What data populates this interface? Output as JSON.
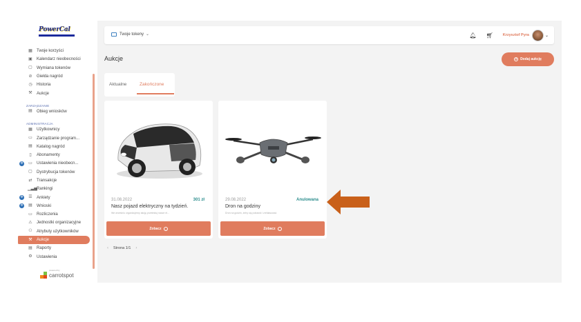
{
  "logo": {
    "text": "PowerCal"
  },
  "sidebar": {
    "items": [
      {
        "label": "Twoje korzyści",
        "icon": "grid-icon"
      },
      {
        "label": "Kalendarz nieobecności",
        "icon": "calendar-icon"
      },
      {
        "label": "Wymiana tokenów",
        "icon": "token-icon"
      },
      {
        "label": "Giełda nagród",
        "icon": "exchange-icon"
      },
      {
        "label": "Historia",
        "icon": "history-icon"
      },
      {
        "label": "Aukcje",
        "icon": "auction-icon"
      }
    ],
    "section_manage": "ZARZĄDZANIE",
    "manage_items": [
      {
        "label": "Obieg wniosków",
        "icon": "flow-icon"
      }
    ],
    "section_admin": "ADMINISTRACJA",
    "admin_items": [
      {
        "label": "Użytkownicy",
        "icon": "users-icon"
      },
      {
        "label": "Zarządzanie program...",
        "icon": "program-icon"
      },
      {
        "label": "Katalog nagród",
        "icon": "catalog-icon"
      },
      {
        "label": "Abonamenty",
        "icon": "subscription-icon"
      },
      {
        "label": "Ustawienia nieobecn...",
        "icon": "absence-settings-icon"
      },
      {
        "label": "Dystrybucja tokenów",
        "icon": "distribution-icon"
      },
      {
        "label": "Transakcje",
        "icon": "transactions-icon"
      },
      {
        "label": "Rankingi",
        "icon": "ranking-icon"
      },
      {
        "label": "Ankiety",
        "icon": "survey-icon"
      },
      {
        "label": "Wnioski",
        "icon": "requests-icon"
      },
      {
        "label": "Rozliczenia",
        "icon": "settlements-icon"
      },
      {
        "label": "Jednostki organizacyjne",
        "icon": "org-units-icon"
      },
      {
        "label": "Atrybuty użytkowników",
        "icon": "attributes-icon"
      },
      {
        "label": "Aukcje",
        "icon": "auction-icon"
      },
      {
        "label": "Raporty",
        "icon": "reports-icon"
      },
      {
        "label": "Ustawienia",
        "icon": "settings-icon"
      }
    ],
    "powered_by": "powered by",
    "brand": "carrotspot"
  },
  "topbar": {
    "tokens_label": "Twoje tokeny",
    "user_name": "Krzysztof Pyra"
  },
  "page": {
    "title": "Aukcje",
    "add_button": "Dodaj aukcję",
    "tabs": [
      "Aktualne",
      "Zakończone"
    ]
  },
  "cards": [
    {
      "date": "31.08.2022",
      "extra": "301 zł",
      "title": "Nasz pojazd elektryczny na tydzień.",
      "desc": "We wrześniu organizujemy akcję przetestuj nasze el...",
      "button": "Zobacz"
    },
    {
      "date": "29.08.2022",
      "extra": "Anulowana",
      "title": "Dron na godziny",
      "desc": "Dron na godzin, żeby się pobawić i zrelaksować",
      "button": "Zobacz"
    }
  ],
  "pager": {
    "label": "Strona 1/1"
  },
  "colors": {
    "accent": "#e07c5e",
    "status": "#2a8c8c",
    "arrow": "#c9601a"
  }
}
